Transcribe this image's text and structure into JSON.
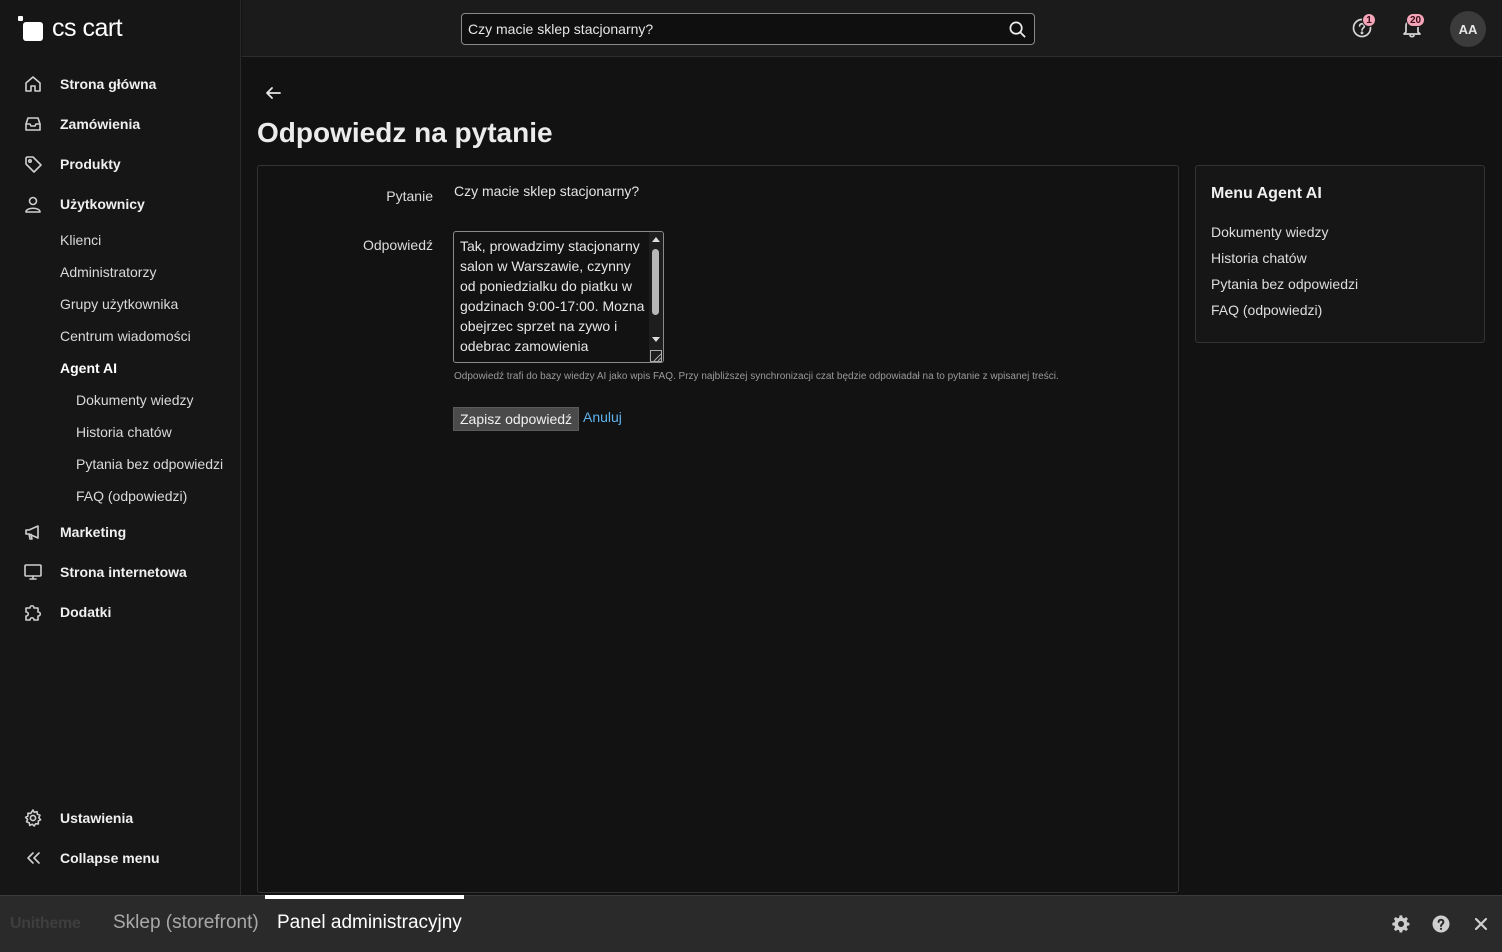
{
  "app": {
    "logo_text": "cs cart"
  },
  "header": {
    "search": {
      "value": "Czy macie sklep stacjonarny?",
      "placeholder": "Czy macie sklep stacjonarny?"
    },
    "help_badge": "1",
    "notifications_badge": "20",
    "avatar_initials": "AA"
  },
  "sidebar": {
    "items": [
      {
        "label": "Strona główna",
        "icon": "home-icon"
      },
      {
        "label": "Zamówienia",
        "icon": "inbox-icon"
      },
      {
        "label": "Produkty",
        "icon": "tag-icon"
      },
      {
        "label": "Użytkownicy",
        "icon": "user-icon"
      }
    ],
    "users_sub": [
      "Klienci",
      "Administratorzy",
      "Grupy użytkownika",
      "Centrum wiadomości",
      "Agent AI"
    ],
    "agent_sub": [
      "Dokumenty wiedzy",
      "Historia chatów",
      "Pytania bez odpowiedzi",
      "FAQ (odpowiedzi)"
    ],
    "items_after": [
      {
        "label": "Marketing",
        "icon": "megaphone-icon"
      },
      {
        "label": "Strona internetowa",
        "icon": "monitor-icon"
      },
      {
        "label": "Dodatki",
        "icon": "puzzle-icon"
      }
    ],
    "bottom": [
      {
        "label": "Ustawienia",
        "icon": "gear-icon"
      },
      {
        "label": "Collapse menu",
        "icon": "double-chevron-left-icon"
      }
    ]
  },
  "page": {
    "title": "Odpowiedz na pytanie",
    "question_label": "Pytanie",
    "question_text": "Czy macie sklep stacjonarny?",
    "answer_label": "Odpowiedź",
    "answer_value": "Tak, prowadzimy stacjonarny salon w Warszawie, czynny od poniedzialku do piatku w godzinach 9:00-17:00. Mozna obejrzec sprzet na zywo i odebrac zamowienia",
    "hint": "Odpowiedź trafi do bazy wiedzy AI jako wpis FAQ. Przy najbliższej synchronizacji czat będzie odpowiadał na to pytanie z wpisanej treści.",
    "save_label": "Zapisz odpowiedź",
    "cancel_label": "Anuluj"
  },
  "side_menu": {
    "title": "Menu Agent AI",
    "links": [
      "Dokumenty wiedzy",
      "Historia chatów",
      "Pytania bez odpowiedzi",
      "FAQ (odpowiedzi)"
    ]
  },
  "bottom_bar": {
    "logo_a": "Uni",
    "logo_b": "theme",
    "tab_storefront": "Sklep (storefront)",
    "tab_admin": "Panel administracyjny"
  }
}
